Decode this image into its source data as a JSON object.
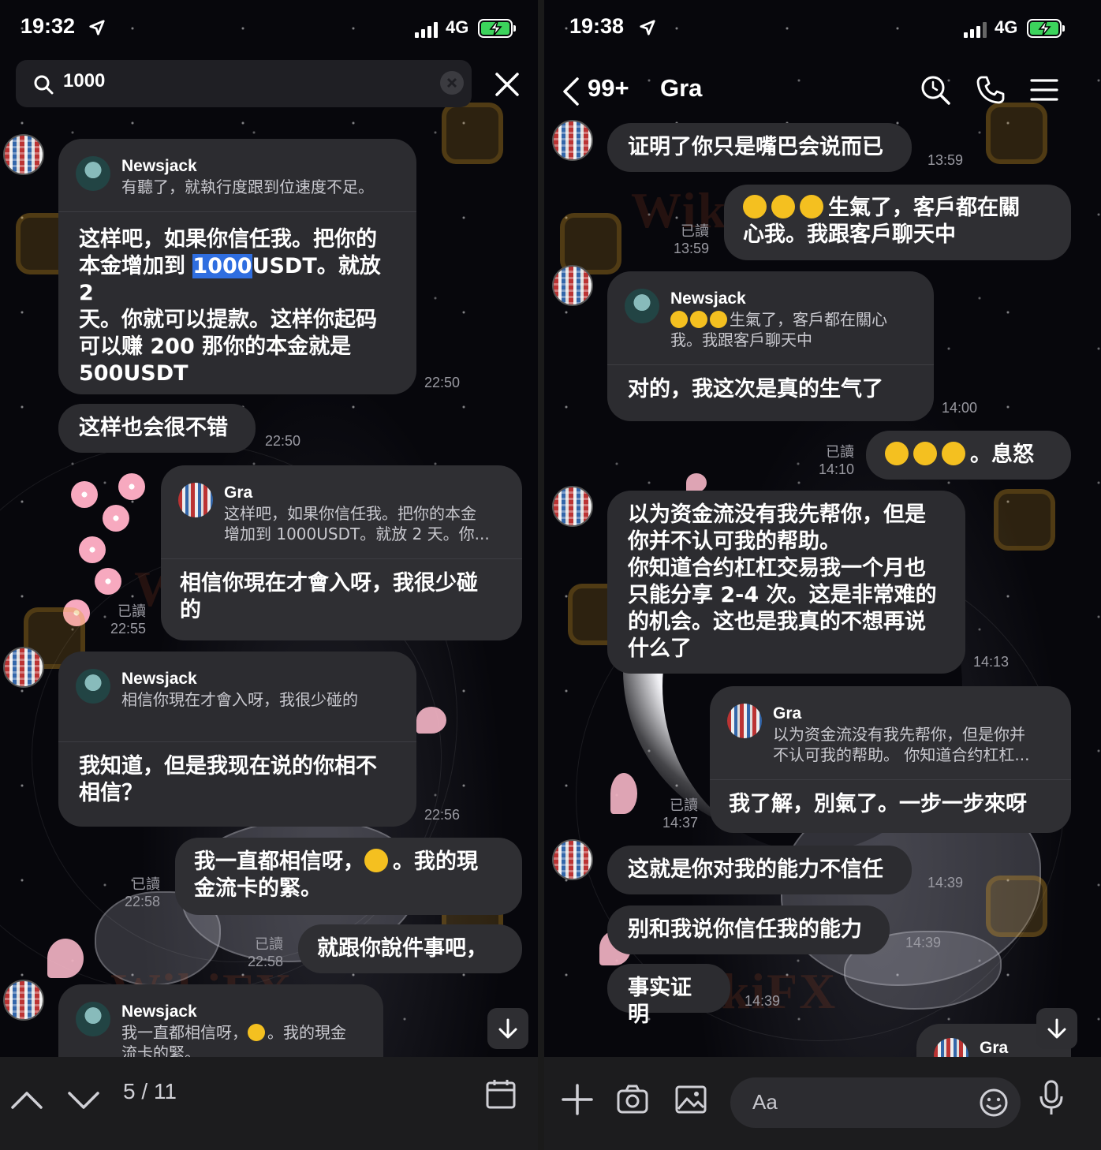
{
  "left": {
    "status": {
      "time": "19:32",
      "network": "4G"
    },
    "search": {
      "value": "1000"
    },
    "messages": {
      "m1": {
        "quote_name": "Newsjack",
        "quote_text": "有聽了，就執行度跟到位速度不足。",
        "text_a": "这样吧，如果你信任我。把你的\n本金增加到 ",
        "highlight": "1000",
        "text_b": "USDT。就放 2\n天。你就可以提款。这样你起码\n可以赚 200 那你的本金就是\n500USDT",
        "time": "22:50"
      },
      "m2": {
        "text": "这样也会很不错",
        "time": "22:50"
      },
      "m3": {
        "quote_name": "Gra",
        "quote_text": "这样吧，如果你信任我。把你的本金\n增加到 1000USDT。就放 2 天。你...",
        "text": "相信你現在才會入呀，我很少碰\n的",
        "read": "已讀",
        "time": "22:55"
      },
      "m4": {
        "quote_name": "Newsjack",
        "quote_text": "相信你現在才會入呀，我很少碰的",
        "text": "我知道，但是我现在说的你相不\n相信？",
        "time": "22:56"
      },
      "m5": {
        "text_a": "我一直都相信呀，",
        "text_b": "。我的現\n金流卡的緊。",
        "read": "已讀",
        "time": "22:58"
      },
      "m6": {
        "text": "就跟你說件事吧，",
        "read": "已讀",
        "time": "22:58"
      },
      "m7": {
        "quote_name": "Newsjack",
        "quote_text_a": "我一直都相信呀，",
        "quote_text_b": "。我的現金\n流卡的緊。"
      }
    },
    "pager": "5 / 11"
  },
  "right": {
    "status": {
      "time": "19:38",
      "network": "4G"
    },
    "header": {
      "back_count": "99+",
      "title": "Gra"
    },
    "messages": {
      "r1": {
        "text": "证明了你只是嘴巴会说而已",
        "time": "13:59"
      },
      "r2": {
        "text": "生氣了，客戶都在關\n心我。我跟客戶聊天中",
        "read": "已讀",
        "time": "13:59"
      },
      "r3": {
        "quote_name": "Newsjack",
        "quote_text": "生氣了，客戶都在關心\n我。我跟客戶聊天中",
        "text": "对的，我这次是真的生气了",
        "time": "14:00"
      },
      "r4": {
        "text": "。息怒",
        "read": "已讀",
        "time": "14:10"
      },
      "r5": {
        "text": "以为资金流没有我先帮你，但是\n你并不认可我的帮助。\n你知道合约杠杠交易我一个月也\n只能分享 2-4 次。这是非常难的\n的机会。这也是我真的不想再说\n什么了",
        "time": "14:13"
      },
      "r6": {
        "quote_name": "Gra",
        "quote_text": "以为资金流没有我先帮你，但是你并\n不认可我的帮助。 你知道合约杠杠...",
        "text": "我了解，別氣了。一步一步來呀",
        "read": "已讀",
        "time": "14:37"
      },
      "r7": {
        "text": "这就是你对我的能力不信任",
        "time": "14:39"
      },
      "r8": {
        "text": "别和我说你信任我的能力",
        "time": "14:39"
      },
      "r9": {
        "text": "事实证明",
        "time": "14:39"
      },
      "r10": {
        "quote_name": "Gra"
      }
    },
    "composer": {
      "placeholder": "Aa"
    }
  },
  "watermark": "WikiFX",
  "colors": {
    "bubble": "#2c2c30",
    "highlight": "#2f6ee0",
    "battery": "#3cd35c",
    "background": "#07070c"
  }
}
